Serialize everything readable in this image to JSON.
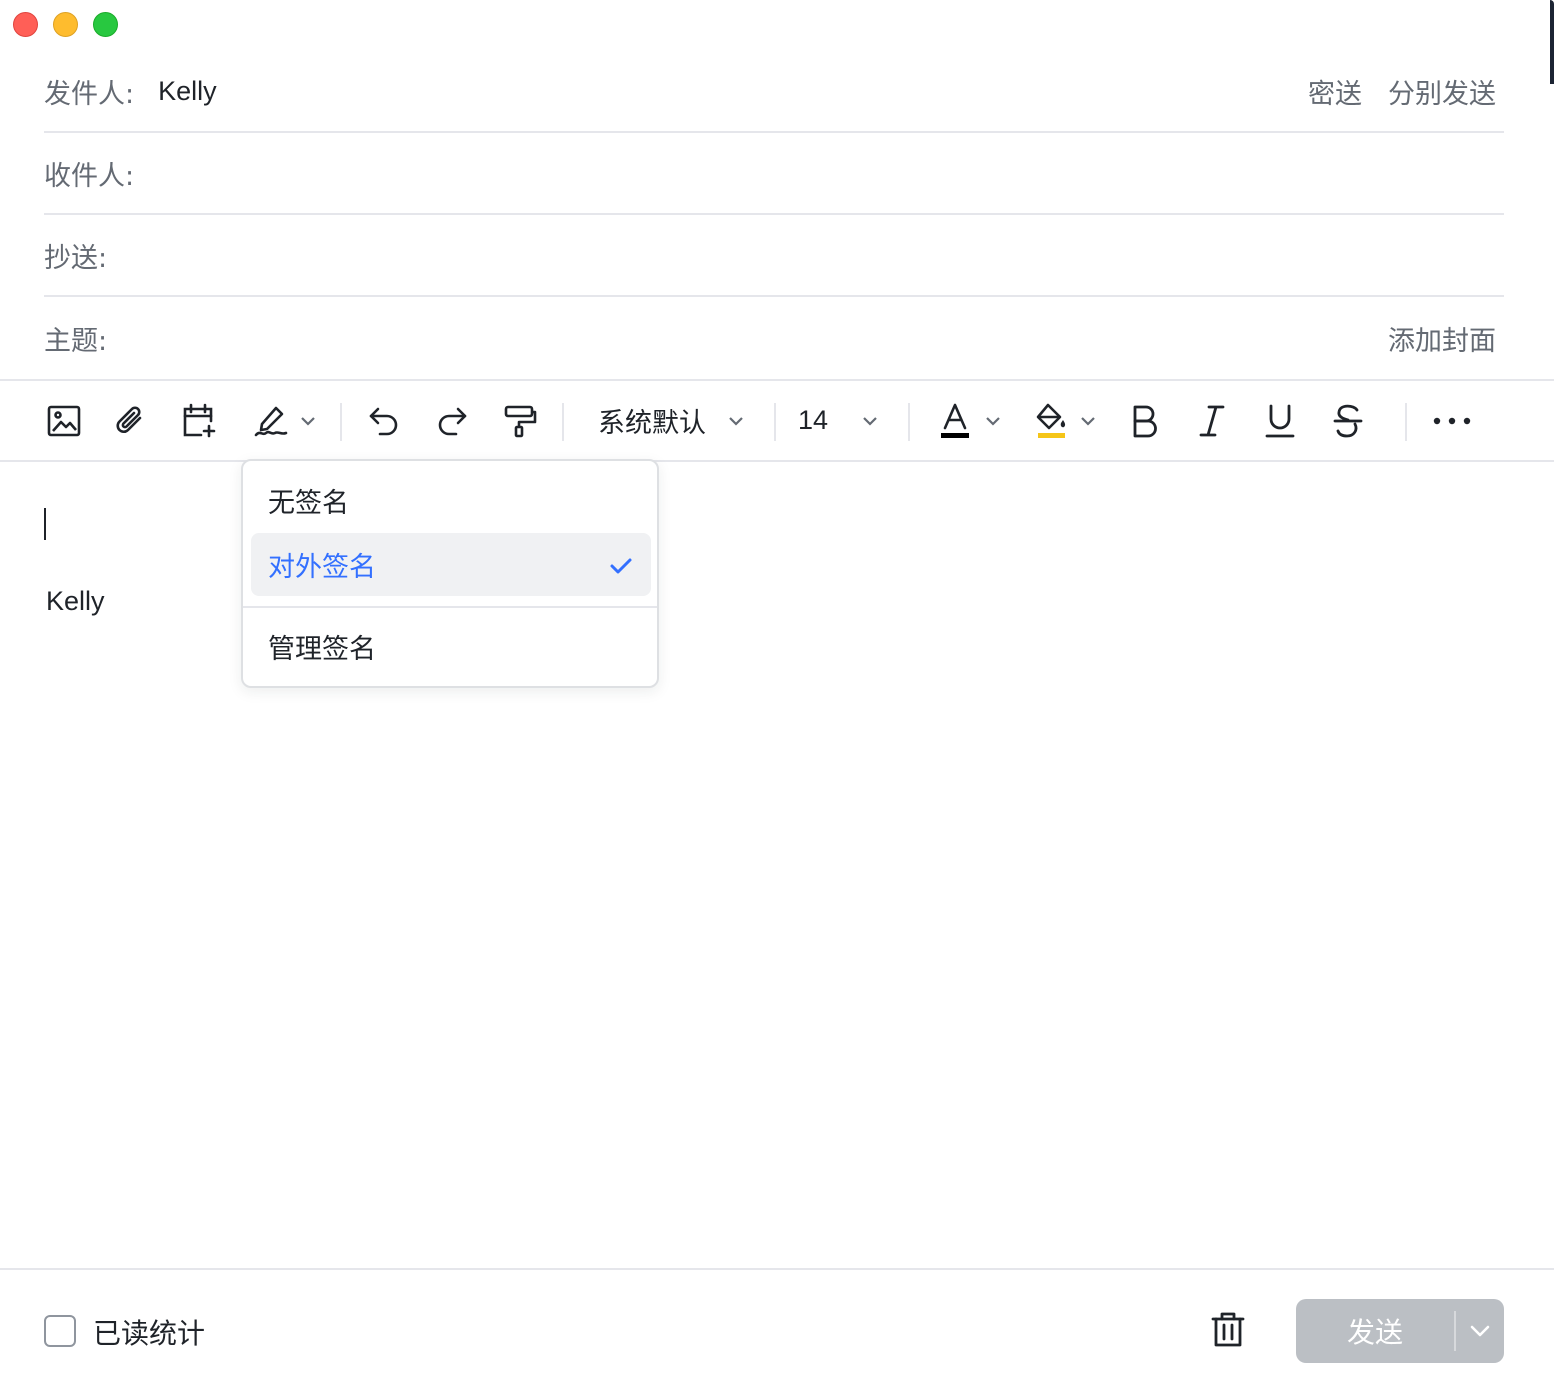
{
  "header": {
    "from_label": "发件人:",
    "from_value": "Kelly",
    "bcc_label": "密送",
    "separate_send_label": "分别发送",
    "to_label": "收件人:",
    "cc_label": "抄送:",
    "subject_label": "主题:",
    "add_cover_label": "添加封面"
  },
  "toolbar": {
    "font_family": "系统默认",
    "font_size": "14",
    "icons": [
      "image-icon",
      "attachment-icon",
      "calendar-add-icon",
      "signature-icon",
      "undo-icon",
      "redo-icon",
      "format-painter-icon",
      "text-color-icon",
      "highlight-color-icon",
      "bold-icon",
      "italic-icon",
      "underline-icon",
      "strikethrough-icon",
      "more-icon"
    ],
    "text_color": "#000000",
    "highlight_color": "#f5c518"
  },
  "editor": {
    "signature_text": "Kelly"
  },
  "signature_menu": {
    "items": [
      {
        "label": "无签名",
        "selected": false
      },
      {
        "label": "对外签名",
        "selected": true
      },
      {
        "label": "管理签名",
        "selected": false
      }
    ],
    "accent_color": "#3370ff"
  },
  "footer": {
    "read_stats_label": "已读统计",
    "read_stats_checked": false,
    "send_label": "发送",
    "send_disabled_color": "#bbbfc4"
  }
}
